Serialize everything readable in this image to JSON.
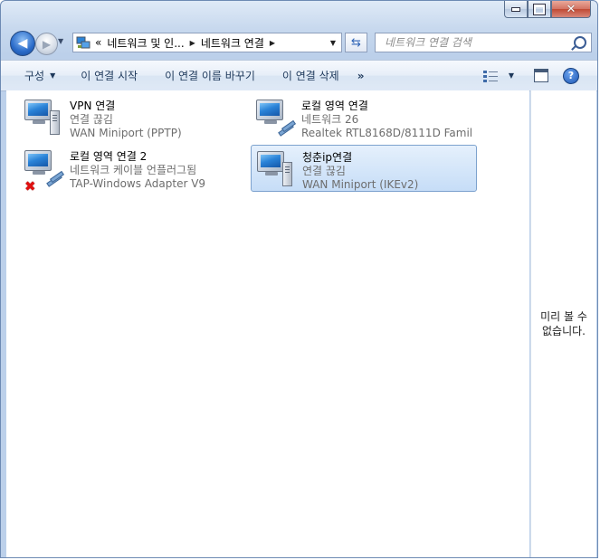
{
  "window": {
    "caption": {
      "minimize": "–",
      "maximize": "□",
      "close": "✕"
    }
  },
  "nav": {
    "breadcrumbs": [
      "«",
      "네트워크 및 인...",
      "네트워크 연결"
    ],
    "search_placeholder": "네트워크 연결 검색"
  },
  "toolbar": {
    "organize": "구성",
    "start_connection": "이 연결 시작",
    "rename_connection": "이 연결 이름 바꾸기",
    "delete_connection": "이 연결 삭제",
    "more": "»"
  },
  "connections": [
    {
      "name": "VPN 연결",
      "status": "연결 끊김",
      "device": "WAN Miniport (PPTP)",
      "icon": "vpn-icon",
      "selected": false,
      "error": false
    },
    {
      "name": "로컬 영역 연결",
      "status": "네트워크  26",
      "device": "Realtek RTL8168D/8111D Famil...",
      "icon": "lan-icon",
      "selected": false,
      "error": false
    },
    {
      "name": "로컬 영역 연결 2",
      "status": "네트워크 케이블 언플러그됨",
      "device": "TAP-Windows Adapter V9",
      "icon": "lan-icon",
      "selected": false,
      "error": true
    },
    {
      "name": "청춘ip연결",
      "status": "연결 끊김",
      "device": "WAN Miniport (IKEv2)",
      "icon": "vpn-icon",
      "selected": true,
      "error": false
    }
  ],
  "preview": {
    "text_line1": "미리 볼 수",
    "text_line2": "없습니다."
  }
}
